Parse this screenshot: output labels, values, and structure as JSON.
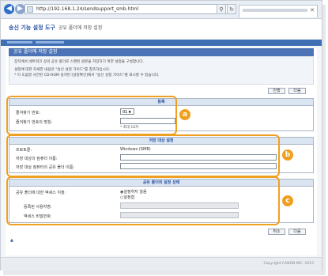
{
  "browser": {
    "address": "http://192.168.1.24/sendsupport_smb.html"
  },
  "app": {
    "title": "송신 기능 설정 도구",
    "subtitle": "공유 폴더에 저장 설정"
  },
  "page": {
    "header": "공유 폴더에 저장 설정",
    "description_lines": [
      "장치에서 네트워크 상의 공유 폴더로 스캔된 원본을 저장하기 위한 설정을 구성합니다.",
      "설정에 대한 자세한 내용은 \"송신 설정 가이드\"를 참조하십시오.",
      "* 이 도움말 사전된 CD-ROM 설치된 [설정확인]에서 \"송신 설정 가이드\"를 표시할 수 있습니다."
    ],
    "next_label": "다음",
    "prev_label": "진행",
    "bottom_btn1": "취소",
    "bottom_btn2": "다음",
    "top_link": "▲"
  },
  "section_a": {
    "header": "등록",
    "fav_number_label": "즐겨찾기 번호:",
    "fav_number_value": "01",
    "fav_name_label": "즐겨찾기 번호의 명칭:",
    "fav_name_note": "* 최대 16자"
  },
  "section_b": {
    "header": "저장 대상 설정",
    "protocol_label": "프로토콜:",
    "protocol_value": "Windows (SMB)",
    "host_label": "저장 대상의 컴퓨터 이름:",
    "folder_label": "저장 대상 컴퓨터의 공유 폴더 이름:"
  },
  "section_c": {
    "header": "공유 폴더의 설정 상태",
    "access_label": "공유 폴더에 대한 액세스 지정:",
    "radio_off": "설정하지 않음",
    "radio_on": "설정함",
    "user_label": "등록된 사용자명:",
    "pass_label": "액세스 비밀번호:"
  },
  "callouts": [
    "a",
    "b",
    "c"
  ],
  "footer": {
    "copyright": "Copyright CANON INC. 2015"
  }
}
